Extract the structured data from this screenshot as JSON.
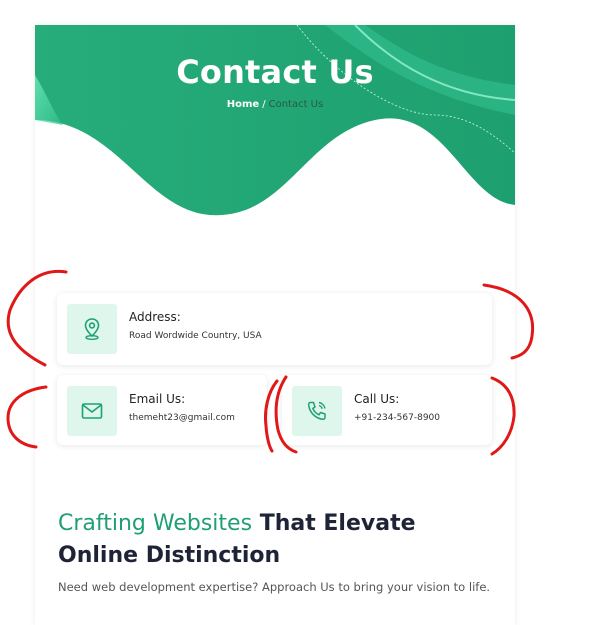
{
  "hero": {
    "title": "Contact Us",
    "breadcrumb": {
      "home": "Home",
      "separator": "/",
      "current": "Contact Us"
    }
  },
  "contact_cards": {
    "address": {
      "label": "Address:",
      "value": "Road Wordwide Country, USA",
      "icon": "location-pin-icon"
    },
    "email": {
      "label": "Email Us:",
      "value": "themeht23@gmail.com",
      "icon": "envelope-icon"
    },
    "call": {
      "label": "Call Us:",
      "value": "+91-234-567-8900",
      "icon": "phone-icon"
    }
  },
  "section": {
    "heading_accent": "Crafting Websites",
    "heading_rest": " That Elevate Online Distinction",
    "lede": "Need web development expertise? Approach Us to bring your vision to life."
  },
  "colors": {
    "brand_green": "#1fa074",
    "icon_bg": "#dff6ec",
    "annotation_red": "#e01818"
  }
}
